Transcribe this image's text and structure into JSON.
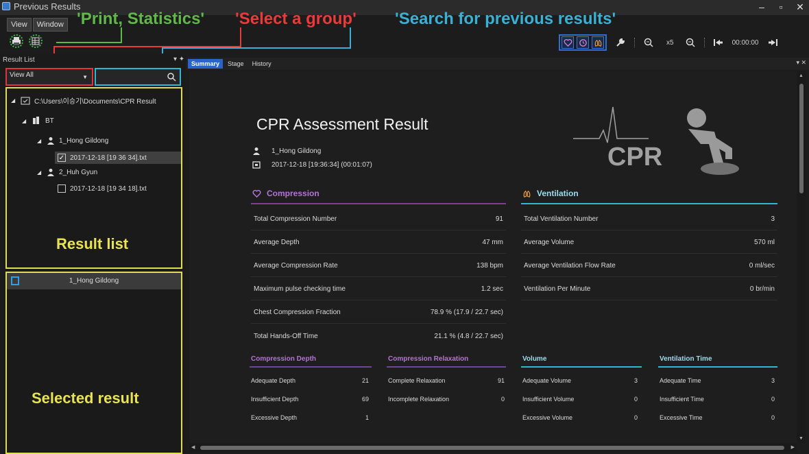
{
  "window": {
    "title": "Previous Results"
  },
  "menu": {
    "view": "View",
    "window": "Window"
  },
  "annotations": {
    "print": "'Print, Statistics'",
    "group": "'Select a group'",
    "search": "'Search for previous results'",
    "result_list": "Result list",
    "selected_result": "Selected result"
  },
  "toolbar": {
    "zoom_level": "x5",
    "time": "00:00:00"
  },
  "left_panel": {
    "title": "Result List",
    "group_select": "View All",
    "search_value": "",
    "tree": {
      "root": "C:\\Users\\이승기\\Documents\\CPR Result",
      "group": "BT",
      "users": [
        {
          "name": "1_Hong Gildong",
          "file": "2017-12-18 [19 36 34].txt",
          "checked": true
        },
        {
          "name": "2_Huh Gyun",
          "file": "2017-12-18 [19 34 18].txt",
          "checked": false
        }
      ]
    },
    "selected_name": "1_Hong Gildong"
  },
  "tabs": [
    "Summary",
    "Stage",
    "History"
  ],
  "report": {
    "title": "CPR Assessment Result",
    "name": "1_Hong Gildong",
    "datetime": "2017-12-18 [19:36:34] (00:01:07)",
    "logo_text": "CPR",
    "compression": {
      "heading": "Compression",
      "rows": [
        {
          "label": "Total Compression Number",
          "value": "91"
        },
        {
          "label": "Average Depth",
          "value": "47 mm"
        },
        {
          "label": "Average Compression Rate",
          "value": "138 bpm"
        },
        {
          "label": "Maximum pulse checking time",
          "value": "1.2 sec"
        },
        {
          "label": "Chest Compression Fraction",
          "value": "78.9 % (17.9 / 22.7 sec)"
        },
        {
          "label": "Total Hands-Off Time",
          "value": "21.1 % (4.8 / 22.7 sec)"
        }
      ]
    },
    "ventilation": {
      "heading": "Ventilation",
      "rows": [
        {
          "label": "Total Ventilation Number",
          "value": "3"
        },
        {
          "label": "Average Volume",
          "value": "570 ml"
        },
        {
          "label": "Average Ventilation Flow Rate",
          "value": "0 ml/sec"
        },
        {
          "label": "Ventilation Per Minute",
          "value": "0 br/min"
        }
      ]
    },
    "breakdown": [
      {
        "heading": "Compression Depth",
        "color": "purple",
        "rows": [
          {
            "label": "Adequate Depth",
            "value": "21"
          },
          {
            "label": "Insufficient Depth",
            "value": "69"
          },
          {
            "label": "Excessive Depth",
            "value": "1"
          }
        ]
      },
      {
        "heading": "Compression Relaxation",
        "color": "purple",
        "rows": [
          {
            "label": "Complete Relaxation",
            "value": "91"
          },
          {
            "label": "Incomplete Relaxation",
            "value": "0"
          }
        ]
      },
      {
        "heading": "Volume",
        "color": "cyan",
        "rows": [
          {
            "label": "Adequate Volume",
            "value": "3"
          },
          {
            "label": "Insufficient Volume",
            "value": "0"
          },
          {
            "label": "Excessive Volume",
            "value": "0"
          }
        ]
      },
      {
        "heading": "Ventilation Time",
        "color": "cyan",
        "rows": [
          {
            "label": "Adequate Time",
            "value": "3"
          },
          {
            "label": "Insufficient Time",
            "value": "0"
          },
          {
            "label": "Excessive Time",
            "value": "0"
          }
        ]
      }
    ]
  },
  "colors": {
    "purple": "#b474d4",
    "cyan": "#2fb7d4",
    "accent": "#2a64c8",
    "highlight": "#e2dc55"
  }
}
